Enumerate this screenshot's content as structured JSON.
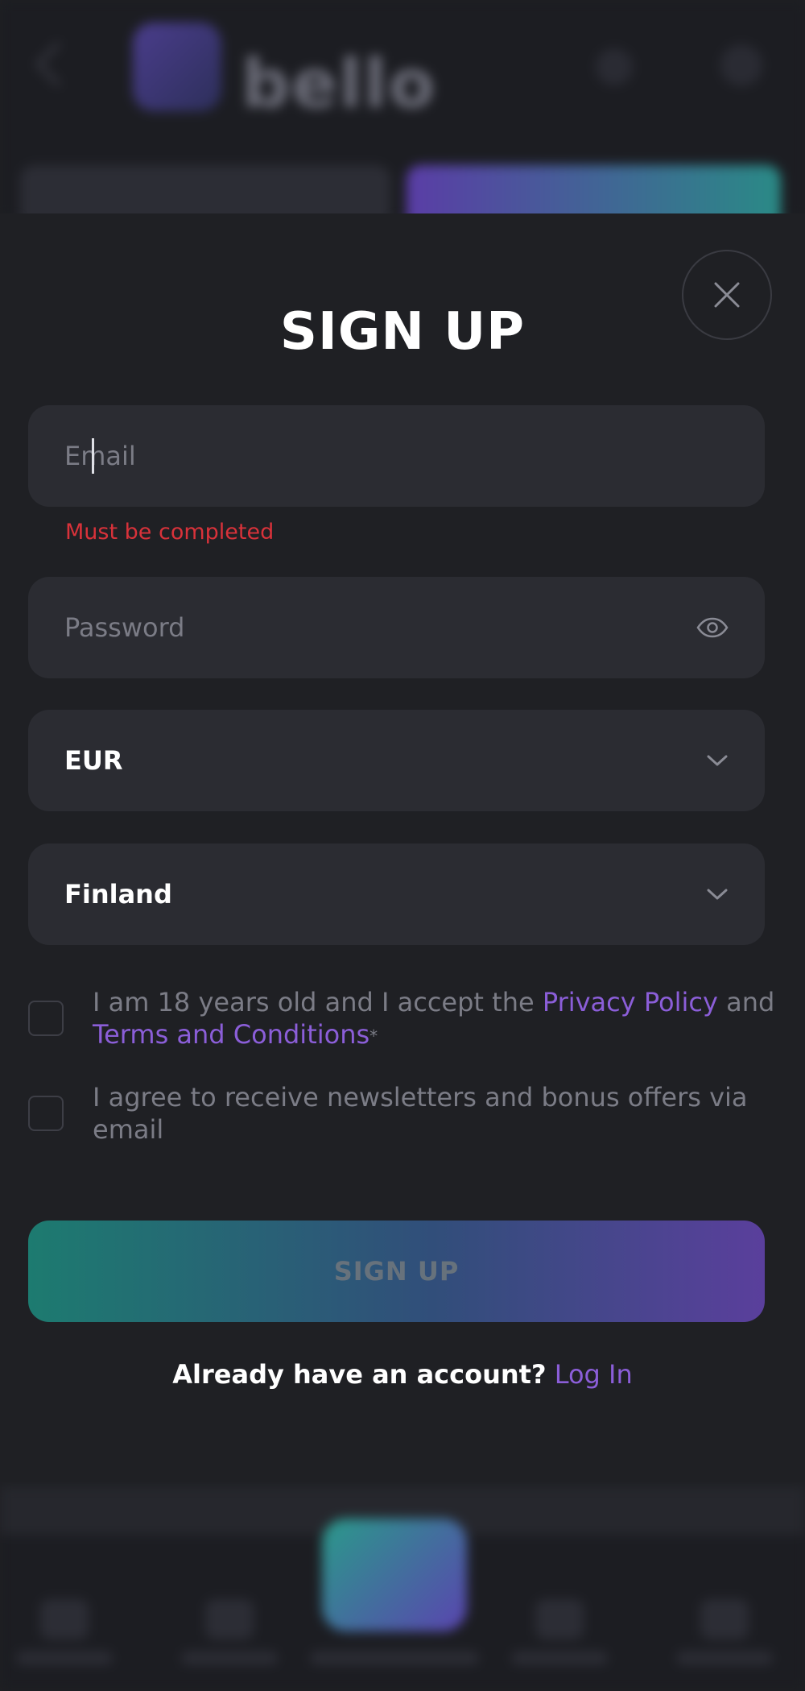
{
  "background": {
    "logo_text": "bello"
  },
  "modal": {
    "title": "SIGN UP",
    "email": {
      "placeholder": "Email",
      "value": ""
    },
    "email_error": "Must be completed",
    "password": {
      "placeholder": "Password",
      "value": ""
    },
    "currency": {
      "selected": "EUR"
    },
    "country": {
      "selected": "Finland"
    },
    "terms": {
      "text_before": "I am 18 years old and I accept the",
      "privacy_link": "Privacy Policy",
      "and_word": "and",
      "terms_link": "Terms and Conditions",
      "required_mark": "*",
      "checked": false
    },
    "newsletter": {
      "text": "I agree to receive newsletters and bonus offers via email",
      "checked": false
    },
    "submit_label": "SIGN UP",
    "footer": {
      "question": "Already have an account?",
      "login_link": "Log In"
    }
  },
  "colors": {
    "background": "#1f2024",
    "field": "#2b2c32",
    "error": "#d8323a",
    "link": "#8b5ed8",
    "button_gradient_start": "#1d7b70",
    "button_gradient_end": "#5a3f9c"
  },
  "icons": {
    "close": "close-icon",
    "password_toggle": "eye-icon",
    "dropdown": "chevron-down-icon"
  }
}
